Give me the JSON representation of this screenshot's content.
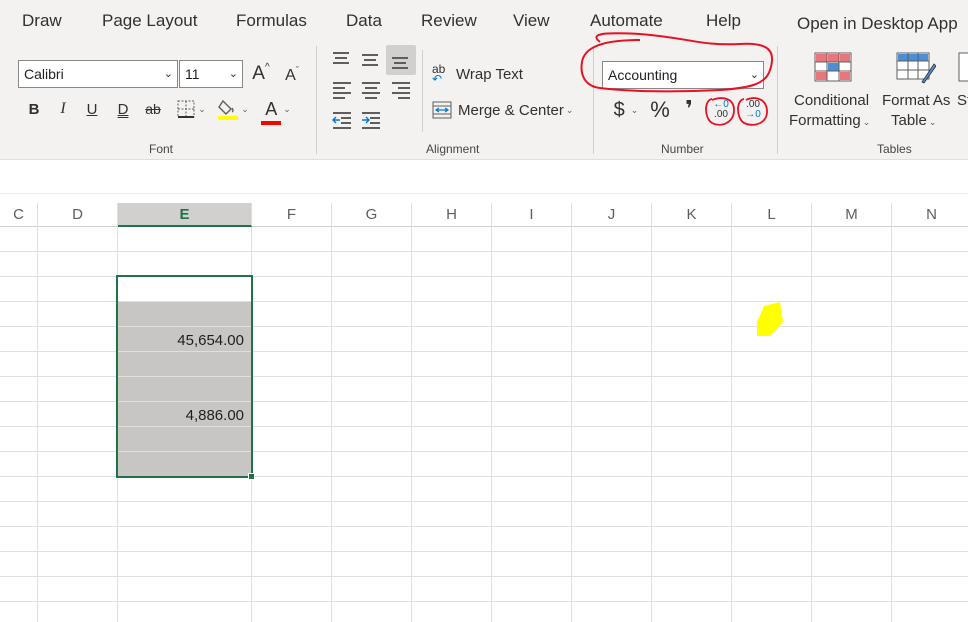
{
  "tabs": [
    "Draw",
    "Page Layout",
    "Formulas",
    "Data",
    "Review",
    "View",
    "Automate",
    "Help"
  ],
  "open_desktop": "Open in Desktop App",
  "font_group": {
    "label": "Font",
    "font_name": "Calibri",
    "font_size": "11",
    "grow": "A",
    "shrink": "A",
    "bold": "B",
    "italic": "I",
    "underline": "U",
    "double_underline": "D",
    "strikethrough": "ab",
    "font_color_letter": "A",
    "fill_color": "#ffff00",
    "font_color": "#ff0000"
  },
  "alignment_group": {
    "label": "Alignment",
    "wrap_text": "Wrap Text",
    "wrap_icon_text": "ab",
    "merge_center": "Merge & Center"
  },
  "number_group": {
    "label": "Number",
    "format": "Accounting",
    "currency": "$",
    "percent": "%",
    "comma": "❜",
    "inc_decimal_top": "←0",
    "inc_decimal_bottom": ".00",
    "dec_decimal_top": ".00",
    "dec_decimal_bottom": "→0"
  },
  "tables_group": {
    "label": "Tables",
    "conditional_1": "Conditional",
    "conditional_2": "Formatting",
    "format_as_table_1": "Format As",
    "format_as_table_2": "Table",
    "styles_partial": "St"
  },
  "columns": [
    "C",
    "D",
    "E",
    "F",
    "G",
    "H",
    "I",
    "J",
    "K",
    "L",
    "M",
    "N"
  ],
  "selected_column": "E",
  "cells": {
    "e_row5": "45,654.00",
    "e_row8": "4,886.00"
  },
  "colors": {
    "accent_green": "#217346",
    "annotation_red": "#e81123",
    "highlight_yellow": "#ffff00"
  }
}
